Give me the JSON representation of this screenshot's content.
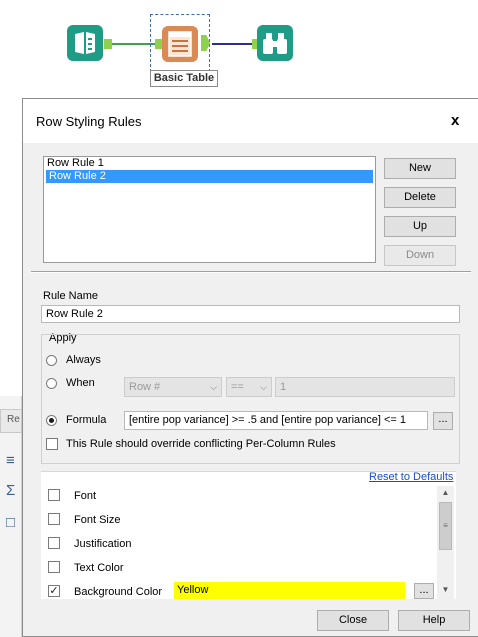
{
  "canvas": {
    "tool_label": "Basic Table",
    "colors": {
      "teal": "#1f9c86",
      "orange": "#d98a55",
      "anchor_green": "#8fd14f"
    }
  },
  "side_panel": {
    "tab_label": "Re"
  },
  "dialog": {
    "title": "Row Styling Rules",
    "close_label": "x",
    "rules": [
      "Row Rule 1",
      "Row Rule 2"
    ],
    "selected_rule_index": 1,
    "buttons": {
      "new": "New",
      "delete": "Delete",
      "up": "Up",
      "down": "Down"
    },
    "rule_name_label": "Rule Name",
    "rule_name_value": "Row Rule 2",
    "apply": {
      "group_label": "Apply",
      "always_label": "Always",
      "when_label": "When",
      "when_field": "Row #",
      "when_operator": "==",
      "when_value": "1",
      "formula_label": "Formula",
      "formula_value": "[entire pop variance] >= .5 and [entire pop variance] <= 1",
      "formula_browse": "...",
      "override_label": "This Rule should override conflicting Per-Column Rules",
      "selected_mode": "Formula"
    },
    "reset_link": "Reset to Defaults",
    "style_options": [
      {
        "label": "Font",
        "checked": false
      },
      {
        "label": "Font Size",
        "checked": false
      },
      {
        "label": "Justification",
        "checked": false
      },
      {
        "label": "Text Color",
        "checked": false
      },
      {
        "label": "Background Color",
        "checked": true
      }
    ],
    "background_color_value": "Yellow",
    "background_color_hex": "#ffff00",
    "color_browse": "...",
    "footer": {
      "close": "Close",
      "help": "Help"
    }
  }
}
